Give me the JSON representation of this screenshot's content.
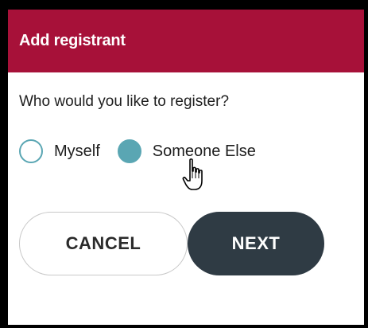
{
  "dialog": {
    "title": "Add registrant",
    "question": "Who would you like to register?",
    "options": [
      {
        "label": "Myself",
        "selected": false
      },
      {
        "label": "Someone Else",
        "selected": true
      }
    ],
    "cancel_label": "CANCEL",
    "next_label": "NEXT"
  },
  "colors": {
    "header_bg": "#a71139",
    "radio_accent": "#5aa6b3",
    "next_button_bg": "#2f3b44"
  },
  "icons": {
    "cursor": "hand-pointer-icon"
  }
}
